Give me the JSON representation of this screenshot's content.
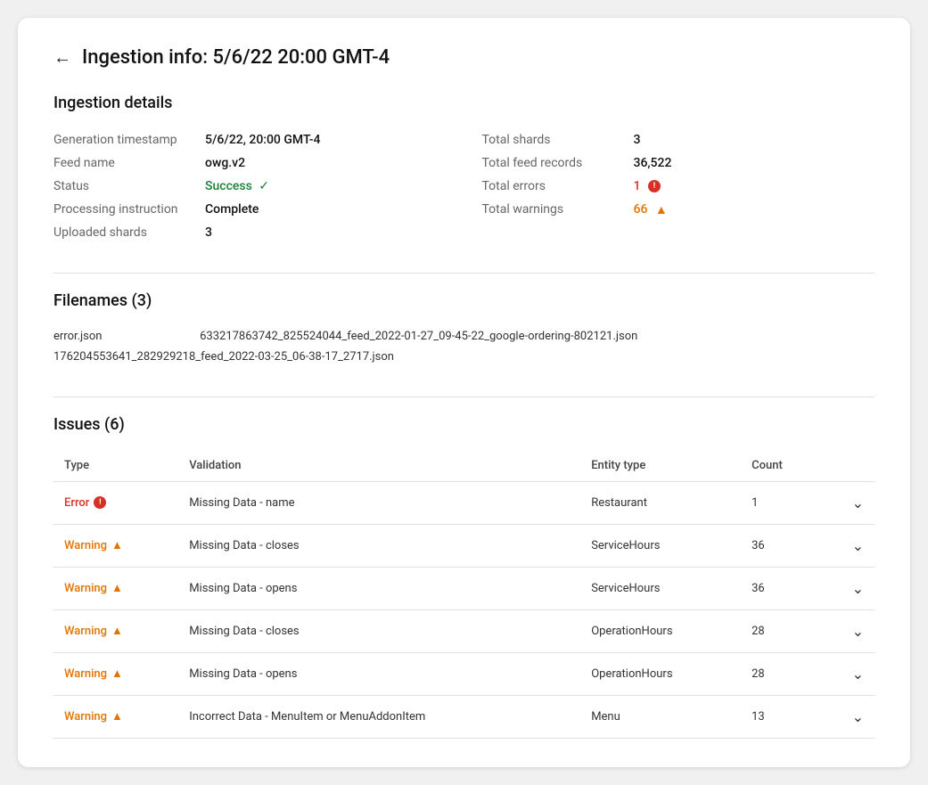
{
  "page": {
    "title": "Ingestion info: 5/6/22 20:00 GMT-4",
    "back_label": "←"
  },
  "ingestion_details": {
    "section_title": "Ingestion details",
    "left_fields": [
      {
        "label": "Generation timestamp",
        "value": "5/6/22, 20:00 GMT-4"
      },
      {
        "label": "Feed name",
        "value": "owg.v2"
      },
      {
        "label": "Status",
        "value": "Success",
        "type": "success"
      },
      {
        "label": "Processing instruction",
        "value": "Complete"
      },
      {
        "label": "Uploaded shards",
        "value": "3"
      }
    ],
    "right_fields": [
      {
        "label": "Total shards",
        "value": "3"
      },
      {
        "label": "Total feed records",
        "value": "36,522"
      },
      {
        "label": "Total errors",
        "value": "1",
        "type": "error"
      },
      {
        "label": "Total warnings",
        "value": "66",
        "type": "warning"
      }
    ]
  },
  "filenames": {
    "section_title": "Filenames (3)",
    "files": [
      "error.json",
      "633217863742_825524044_feed_2022-01-27_09-45-22_google-ordering-802121.json",
      "176204553641_282929218_feed_2022-03-25_06-38-17_2717.json"
    ]
  },
  "issues": {
    "section_title": "Issues (6)",
    "columns": [
      "Type",
      "Validation",
      "Entity type",
      "Count"
    ],
    "rows": [
      {
        "type": "Error",
        "type_kind": "error",
        "validation": "Missing Data - name",
        "entity_type": "Restaurant",
        "count": "1"
      },
      {
        "type": "Warning",
        "type_kind": "warning",
        "validation": "Missing Data - closes",
        "entity_type": "ServiceHours",
        "count": "36"
      },
      {
        "type": "Warning",
        "type_kind": "warning",
        "validation": "Missing Data - opens",
        "entity_type": "ServiceHours",
        "count": "36"
      },
      {
        "type": "Warning",
        "type_kind": "warning",
        "validation": "Missing Data - closes",
        "entity_type": "OperationHours",
        "count": "28"
      },
      {
        "type": "Warning",
        "type_kind": "warning",
        "validation": "Missing Data - opens",
        "entity_type": "OperationHours",
        "count": "28"
      },
      {
        "type": "Warning",
        "type_kind": "warning",
        "validation": "Incorrect Data - MenuItem or MenuAddonItem",
        "entity_type": "Menu",
        "count": "13"
      }
    ]
  }
}
